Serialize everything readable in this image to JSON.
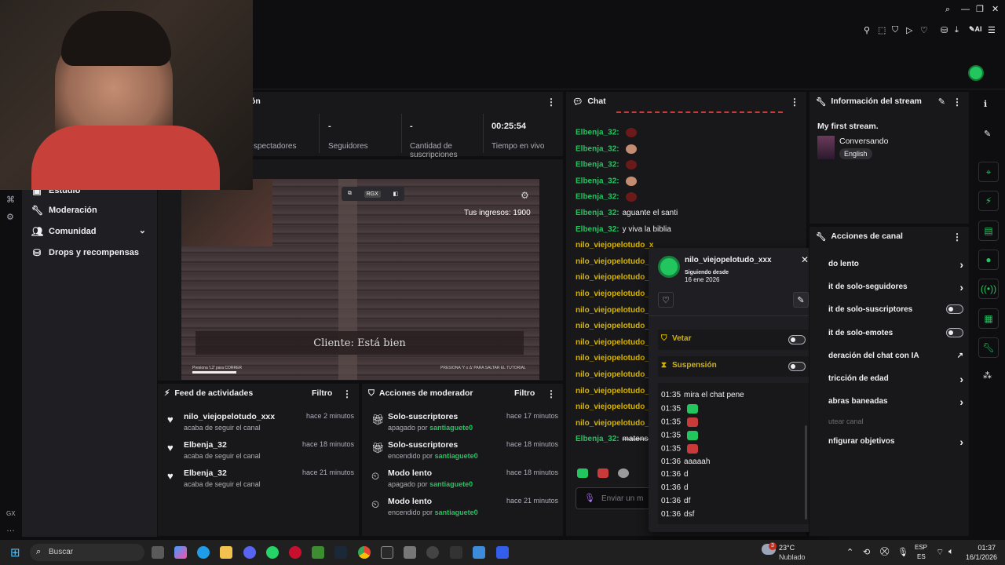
{
  "stats": {
    "viewers_label": "spectadores",
    "followers_value": "-",
    "followers_label": "Seguidores",
    "subs_value": "-",
    "subs_label": "Cantidad de suscripciones",
    "uptime_value": "00:25:54",
    "uptime_label": "Tiempo en vivo",
    "panel_title_fragment": "ón"
  },
  "sidebar": {
    "items": [
      {
        "label": "Estudio",
        "icon": "studio-icon"
      },
      {
        "label": "Moderación",
        "icon": "wrench-icon"
      },
      {
        "label": "Comunidad",
        "icon": "people-icon"
      },
      {
        "label": "Drops y recompensas",
        "icon": "drops-icon"
      }
    ],
    "footer_label": "GX"
  },
  "video": {
    "overlay_income": "Tus ingresos: 1900",
    "subtitle": "Cliente: Está bien",
    "hint_left": "Presiona 'L2' para CORRER",
    "hint_right": "PRESIONA 'Y o Δ' PARA SALTAR EL TUTORIAL",
    "rgx_label": "RGX"
  },
  "feed": {
    "title": "Feed de actividades",
    "filter_label": "Filtro",
    "items": [
      {
        "user": "nilo_viejopelotudo_xxx",
        "action": "acaba de seguir el canal",
        "time": "hace 2 minutos"
      },
      {
        "user": "Elbenja_32",
        "action": "acaba de seguir el canal",
        "time": "hace 18 minutos"
      },
      {
        "user": "Elbenja_32",
        "action": "acaba de seguir el canal",
        "time": "hace 21 minutos"
      }
    ]
  },
  "mod_actions": {
    "title": "Acciones de moderador",
    "filter_label": "Filtro",
    "items": [
      {
        "action": "Solo-suscriptores",
        "state": "apagado por",
        "by": "santiaguete0",
        "time": "hace 17 minutos",
        "icon": "gift-icon"
      },
      {
        "action": "Solo-suscriptores",
        "state": "encendido por",
        "by": "santiaguete0",
        "time": "hace 18 minutos",
        "icon": "gift-icon"
      },
      {
        "action": "Modo lento",
        "state": "apagado por",
        "by": "santiaguete0",
        "time": "hace 18 minutos",
        "icon": "slow-icon"
      },
      {
        "action": "Modo lento",
        "state": "encendido por",
        "by": "santiaguete0",
        "time": "hace 21 minutos",
        "icon": "slow-icon"
      }
    ]
  },
  "chat": {
    "title": "Chat",
    "input_placeholder": "Enviar un m",
    "messages": [
      {
        "user": "Elbenja_32:",
        "text": ""
      },
      {
        "user": "Elbenja_32:",
        "text": ""
      },
      {
        "user": "Elbenja_32:",
        "text": ""
      },
      {
        "user": "Elbenja_32:",
        "text": ""
      },
      {
        "user": "Elbenja_32:",
        "text": ""
      },
      {
        "user": "Elbenja_32:",
        "text": "aguante el santi"
      },
      {
        "user": "Elbenja_32:",
        "text": "y viva la biblia"
      },
      {
        "user": "nilo_viejopelotudo_x",
        "text": ""
      },
      {
        "user": "nilo_viejopelotudo_x",
        "text": ""
      },
      {
        "user": "nilo_viejopelotudo_x",
        "text": ""
      },
      {
        "user": "nilo_viejopelotudo_x",
        "text": ""
      },
      {
        "user": "nilo_viejopelotudo_x",
        "text": ""
      },
      {
        "user": "nilo_viejopelotudo_x",
        "text": ""
      },
      {
        "user": "nilo_viejopelotudo_x",
        "text": ""
      },
      {
        "user": "nilo_viejopelotudo_x",
        "text": ""
      },
      {
        "user": "nilo_viejopelotudo_x",
        "text": ""
      },
      {
        "user": "nilo_viejopelotudo_x",
        "text": ""
      },
      {
        "user": "nilo_viejopelotudo_x",
        "text": ""
      },
      {
        "user": "nilo_viejopelotudo_x",
        "text": ""
      },
      {
        "user": "Elbenja_32:",
        "text": "matense"
      }
    ]
  },
  "usercard": {
    "username": "nilo_viejopelotudo_xxx",
    "following_label": "Siguiendo desde",
    "following_date": "16 ene 2026",
    "ban_label": "Vetar",
    "timeout_label": "Suspensión",
    "log": [
      {
        "time": "01:35",
        "text": "mira el chat pene"
      },
      {
        "time": "01:35",
        "text": ""
      },
      {
        "time": "01:35",
        "text": ""
      },
      {
        "time": "01:35",
        "text": ""
      },
      {
        "time": "01:35",
        "text": ""
      },
      {
        "time": "01:36",
        "text": "aaaaah"
      },
      {
        "time": "01:36",
        "text": "d"
      },
      {
        "time": "01:36",
        "text": "d"
      },
      {
        "time": "01:36",
        "text": "df"
      },
      {
        "time": "01:36",
        "text": "dsf"
      }
    ]
  },
  "stream_info": {
    "title": "Información del stream",
    "stream_title": "My first stream.",
    "category": "Conversando",
    "language": "English"
  },
  "channel_actions": {
    "title": "Acciones de canal",
    "items": [
      {
        "label": "do lento",
        "control": "arrow"
      },
      {
        "label": "it de solo-seguidores",
        "control": "arrow"
      },
      {
        "label": "it de solo-suscriptores",
        "control": "toggle"
      },
      {
        "label": "it de solo-emotes",
        "control": "toggle"
      },
      {
        "label": "deración del chat con IA",
        "control": "external"
      },
      {
        "label": "tricción de edad",
        "control": "arrow"
      },
      {
        "label": "abras baneadas",
        "control": "arrow"
      },
      {
        "label": "utear canal",
        "control": "none"
      },
      {
        "label": "nfigurar objetivos",
        "control": "arrow"
      }
    ]
  },
  "taskbar": {
    "search_placeholder": "Buscar",
    "weather_temp": "23°C",
    "weather_desc": "Nublado",
    "weather_badge": "3",
    "lang_top": "ESP",
    "lang_bottom": "ES",
    "time": "01:37",
    "date": "16/1/2026"
  },
  "colors": {
    "accent_green": "#22c55e",
    "mod_yellow": "#d6b400",
    "panel_bg": "#18181b",
    "page_bg": "#0e0e10"
  }
}
